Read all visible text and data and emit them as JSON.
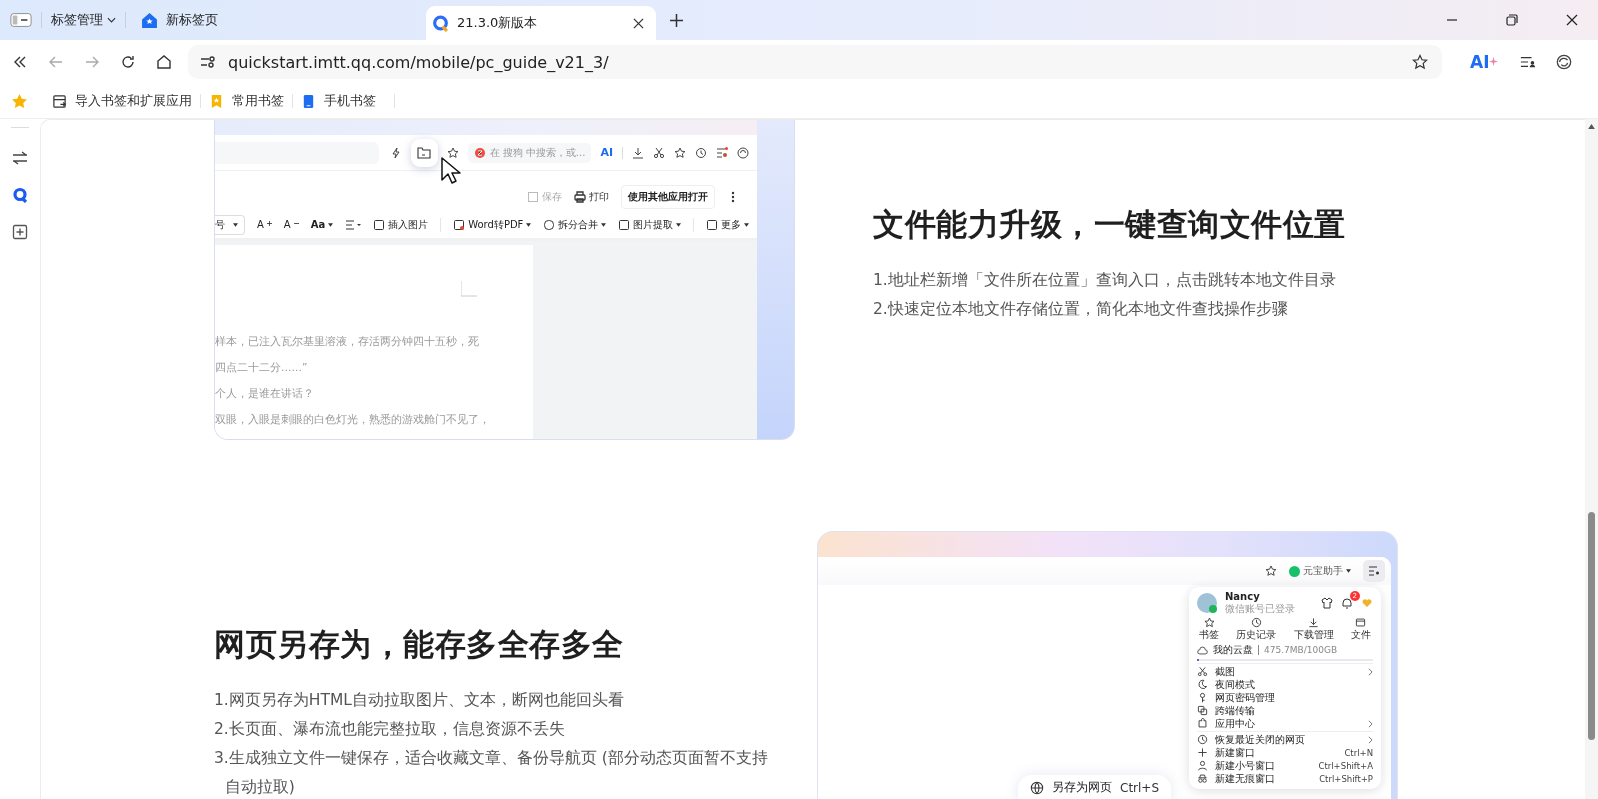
{
  "tab_strip": {
    "tab_manager": "标签管理",
    "tabs": [
      {
        "title": "新标签页",
        "kind": "home",
        "selected": false
      },
      {
        "title": "21.3.0新版本",
        "kind": "site",
        "selected": true
      }
    ]
  },
  "address_bar": {
    "url": "quickstart.imtt.qq.com/mobile/pc_guide_v21_3/",
    "ai_label": "AI"
  },
  "bookmarks": [
    {
      "label": "导入书签和扩展应用",
      "kind": "import"
    },
    {
      "label": "常用书签",
      "kind": "folder"
    },
    {
      "label": "手机书签",
      "kind": "mobile"
    }
  ],
  "file_feature": {
    "title": "文件能力升级，一键查询文件位置",
    "points": [
      "1.地址栏新增「文件所在位置」查询入口，点击跳转本地文件目录",
      "2.快速定位本地文件存储位置，简化本地文件查找操作步骤"
    ],
    "screenshot": {
      "search_placeholder": "在 搜狗 中搜索，或...",
      "ai_label": "AI",
      "doc_actions": [
        {
          "label": "保存",
          "kind": "save",
          "disabled": true
        },
        {
          "label": "打印",
          "kind": "print",
          "disabled": false
        }
      ],
      "open_with_button": "使用其他应用打开",
      "format_tools": [
        {
          "kind": "select",
          "label": "号"
        },
        {
          "kind": "grow",
          "label": "A"
        },
        {
          "kind": "shrink",
          "label": "A"
        },
        {
          "kind": "case",
          "label": "Aa"
        },
        {
          "kind": "align"
        },
        {
          "kind": "image",
          "label": "插入图片"
        },
        {
          "kind": "pdf",
          "label": "Word转PDF"
        },
        {
          "kind": "split",
          "label": "拆分合并"
        },
        {
          "kind": "extract",
          "label": "图片提取"
        },
        {
          "kind": "more",
          "label": "更多"
        }
      ],
      "doc_lines": [
        "样本，已注入瓦尔基里溶液，存活两分钟四十五秒，死",
        "四点二十二分……”",
        "个人，是谁在讲话？",
        "双眼，入眼是刺眼的白色灯光，熟悉的游戏舱门不见了，"
      ]
    }
  },
  "save_feature": {
    "title": "网页另存为，能存多全存多全",
    "points": [
      "1.网页另存为HTML自动拉取图片、文本，断网也能回头看",
      "2.长页面、瀑布流也能完整拉取，信息资源不丢失",
      "3.生成独立文件一键保存，适合收藏文章、备份导航页 (部分动态页面暂不支持自动拉取)"
    ],
    "screenshot": {
      "assistant_label": "元宝助手",
      "menu": {
        "user_name": "Nancy",
        "login_status": "微信账号已登录",
        "notification_count": "2",
        "quick_actions": [
          {
            "label": "书签",
            "kind": "star"
          },
          {
            "label": "历史记录",
            "kind": "clock"
          },
          {
            "label": "下载管理",
            "kind": "download"
          },
          {
            "label": "文件",
            "kind": "file"
          }
        ],
        "cloud": {
          "label": "我的云盘",
          "usage": "475.7MB/100GB",
          "level": 0.01
        },
        "items": [
          {
            "label": "截图",
            "kind": "scissors",
            "submenu": true
          },
          {
            "label": "夜间模式",
            "kind": "moon",
            "submenu": false
          },
          {
            "label": "网页密码管理",
            "kind": "key",
            "submenu": false
          },
          {
            "label": "跨端传输",
            "kind": "transfer",
            "submenu": false
          },
          {
            "label": "应用中心",
            "kind": "apps",
            "submenu": true
          }
        ],
        "window_items": [
          {
            "label": "恢复最近关闭的网页",
            "kind": "restore",
            "submenu": true
          },
          {
            "label": "新建窗口",
            "kind": "plus",
            "shortcut": "Ctrl+N",
            "submenu": false
          },
          {
            "label": "新建小号窗口",
            "kind": "person",
            "shortcut": "Ctrl+Shift+A",
            "submenu": false
          },
          {
            "label": "新建无痕窗口",
            "kind": "incognito",
            "shortcut": "Ctrl+Shift+P",
            "submenu": false
          }
        ]
      },
      "floating_action": {
        "label": "另存为网页",
        "shortcut": "Ctrl+S"
      }
    }
  }
}
